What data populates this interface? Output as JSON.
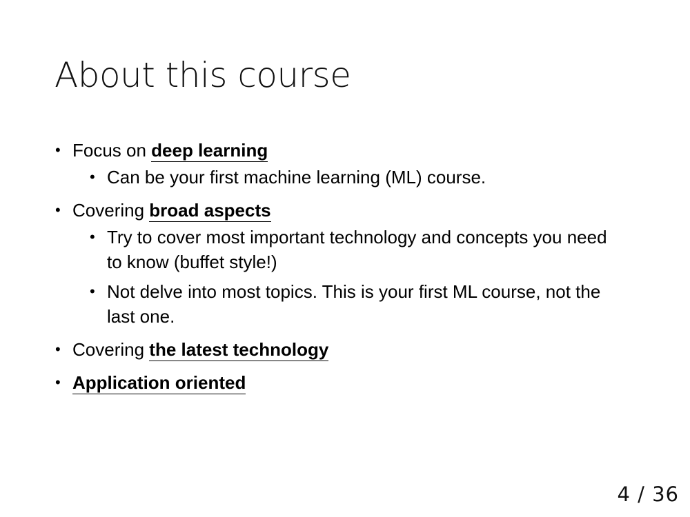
{
  "slide": {
    "title": "About this course",
    "bullets": [
      {
        "prefix": "Focus on ",
        "emphasis": "deep learning",
        "sub": [
          "Can be your first machine learning (ML) course."
        ]
      },
      {
        "prefix": "Covering ",
        "emphasis": "broad aspects",
        "sub": [
          "Try to cover most important technology and concepts you need to know (buffet style!)",
          "Not delve into most topics. This is your first ML course, not the last one."
        ]
      },
      {
        "prefix": "Covering ",
        "emphasis": "the latest technology",
        "sub": []
      },
      {
        "prefix": "",
        "emphasis": "Application oriented",
        "sub": []
      }
    ],
    "page_number": "4 / 36"
  },
  "bullet_glyph": "•"
}
